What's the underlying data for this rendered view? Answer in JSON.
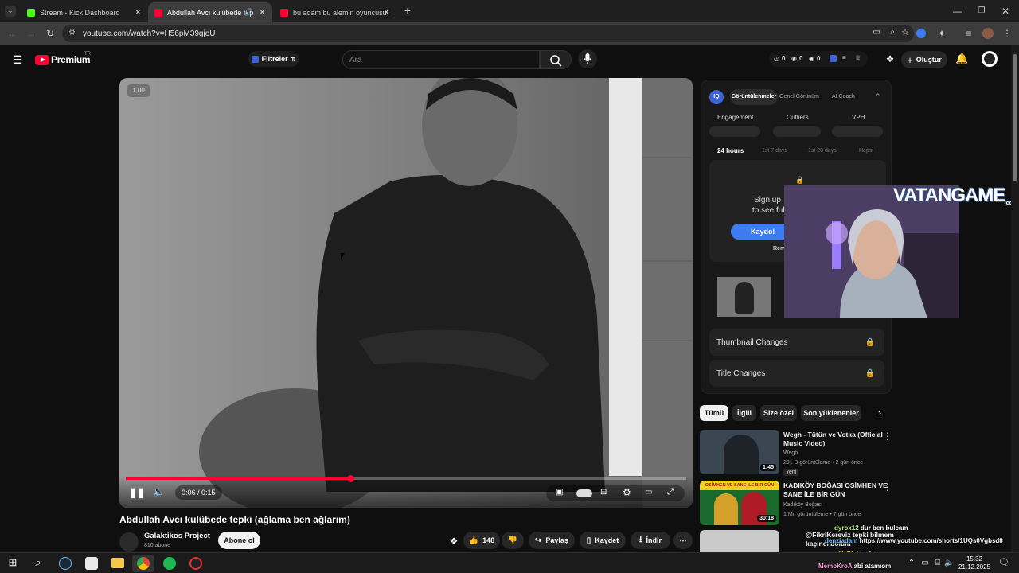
{
  "tabs": [
    {
      "label": "Stream - Kick Dashboard",
      "active": false,
      "color": "#53fc18"
    },
    {
      "label": "Abdullah Avcı kulübede tep",
      "active": true,
      "color": "#ff0033"
    },
    {
      "label": "bu adam bu alemin oyuncusu",
      "active": false,
      "color": "#ff0033"
    }
  ],
  "browser": {
    "url": "youtube.com/watch?v=H56pM39qjoU"
  },
  "youtube": {
    "logo": "Premium",
    "region": "TR",
    "filters_label": "Filtreler",
    "search_placeholder": "Ara",
    "stats": [
      "0",
      "0",
      "0"
    ],
    "create_label": "Oluştur"
  },
  "video": {
    "speed_badge": "1.00",
    "time": "0:06 / 0:15",
    "progress_fraction": 0.4,
    "title": "Abdullah Avcı kulübede tepki (ağlama ben ağlarım)",
    "channel": "Galaktikos Project",
    "subs": "810 abone",
    "subscribe_label": "Abone ol",
    "likes": "148",
    "share_label": "Paylaş",
    "save_label": "Kaydet",
    "download_label": "İndir"
  },
  "iq_panel": {
    "tabs": [
      "Görüntülenmeler",
      "Genel Görünüm",
      "AI Coach"
    ],
    "metrics": [
      "Engagement",
      "Outliers",
      "VPH"
    ],
    "ranges": [
      "24 hours",
      "1st 7 days",
      "1st 28 days",
      "Hepsi"
    ],
    "signup_line1": "Sign up",
    "signup_line2": "to see ful",
    "signup_button": "Kaydol",
    "remind": "Rem",
    "rows": [
      "Thumbnail Changes",
      "Title Changes"
    ]
  },
  "overlay": {
    "brand": "VATANGAME",
    "brand_suffix": ".com"
  },
  "chips": [
    "Tümü",
    "İlgili",
    "Size özel",
    "Son yüklenenler"
  ],
  "recs": [
    {
      "title_line1": "Wegh - Tütün ve Votka (Official",
      "title_line2": "Music Video)",
      "channel": "Wegh",
      "meta": "291 B görüntüleme • 2 gün önce",
      "badge": "Yeni",
      "duration": "1:45"
    },
    {
      "title_line1": "KADIKÖY BOĞASI OSİMHEN VE",
      "title_line2": "SANE İLE BİR GÜN",
      "channel": "Kadıköy Boğası",
      "meta": "1 Mn görüntüleme • 7 gün önce",
      "badge": "",
      "duration": "30:18",
      "thumb_text": "OSİMHEN VE SANE İLE BİR GÜN"
    },
    {
      "title_line1": "@FikriKereviz tepki bilmem",
      "title_line2": "kaçıncı bölüm",
      "channel": "",
      "meta": "",
      "badge": "",
      "duration": ""
    }
  ],
  "chat": [
    {
      "user": "dyrox12",
      "msg": "dur ben bulcam",
      "color": "#b8e986"
    },
    {
      "user": "denziadam",
      "msg": "https://www.youtube.com/shorts/1UQs0Vgbsd8",
      "color": "#6fc3ff"
    },
    {
      "user": "YuPixi",
      "msg": "sadge",
      "color": "#ffd84a"
    },
    {
      "user": "MemoKroA",
      "msg": "abi atamıom",
      "color": "#ff9ed8"
    }
  ],
  "taskbar": {
    "time": "15:32",
    "date": "21.12.2025"
  }
}
